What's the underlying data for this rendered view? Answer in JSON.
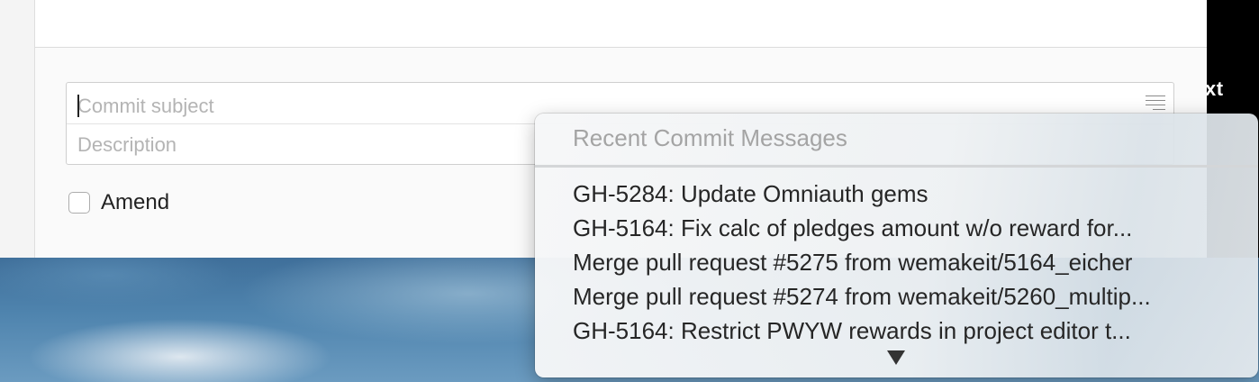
{
  "edge_text": "xt",
  "commit": {
    "subject_placeholder": "Commit subject",
    "description_placeholder": "Description",
    "subject_value": "",
    "description_value": "",
    "recent_button_icon": "list-lines-icon"
  },
  "amend": {
    "label": "Amend",
    "checked": false
  },
  "popup": {
    "header": "Recent Commit Messages",
    "items": [
      "GH-5284: Update Omniauth gems",
      "GH-5164: Fix calc of pledges amount w/o reward for...",
      "Merge pull request #5275 from wemakeit/5164_eicher",
      "Merge pull request #5274 from wemakeit/5260_multip...",
      "GH-5164: Restrict PWYW rewards in project editor t..."
    ],
    "scroll_icon": "triangle-down-icon"
  }
}
